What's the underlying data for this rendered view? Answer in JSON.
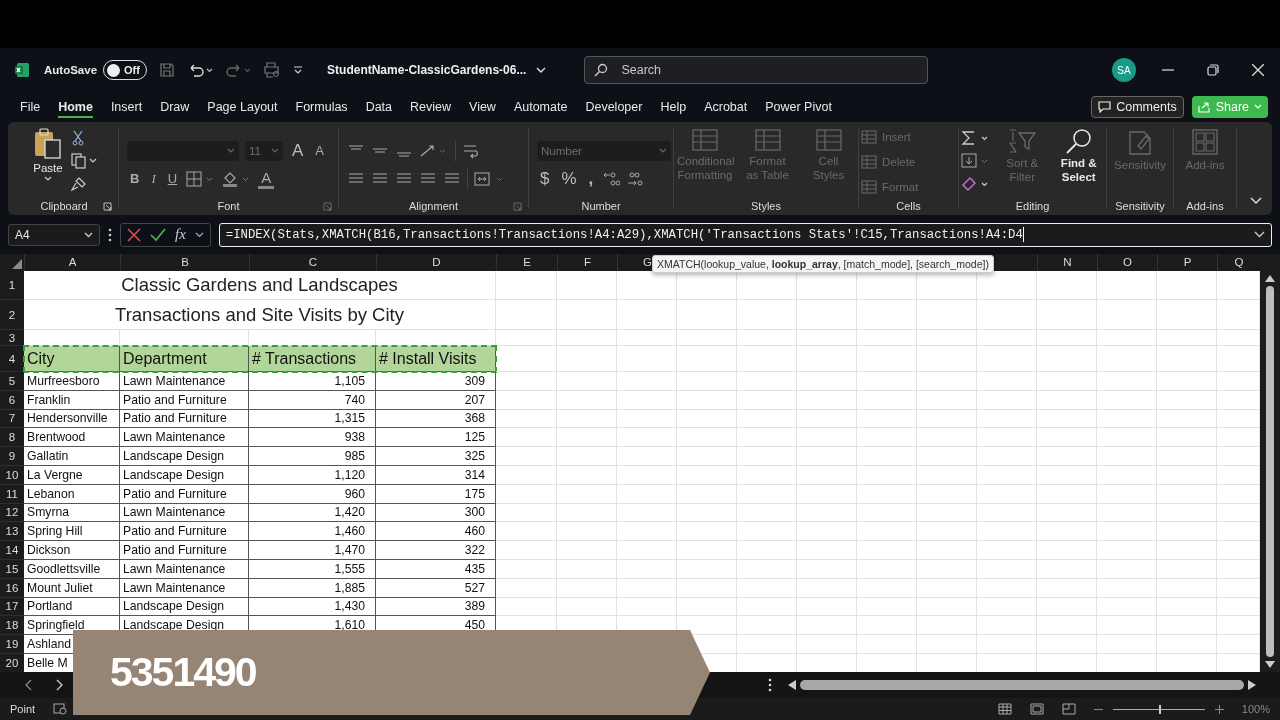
{
  "title_bar": {
    "autosave_label": "AutoSave",
    "autosave": {
      "on": false,
      "label": "Off"
    },
    "file_name": "StudentName-ClassicGardens-06...",
    "search": {
      "placeholder": "Search"
    },
    "avatar": "SA"
  },
  "menu": {
    "tabs": [
      {
        "label": "File",
        "selected": false
      },
      {
        "label": "Home",
        "selected": true
      },
      {
        "label": "Insert",
        "selected": false
      },
      {
        "label": "Draw",
        "selected": false
      },
      {
        "label": "Page Layout",
        "selected": false
      },
      {
        "label": "Formulas",
        "selected": false
      },
      {
        "label": "Data",
        "selected": false
      },
      {
        "label": "Review",
        "selected": false
      },
      {
        "label": "View",
        "selected": false
      },
      {
        "label": "Automate",
        "selected": false
      },
      {
        "label": "Developer",
        "selected": false
      },
      {
        "label": "Help",
        "selected": false
      },
      {
        "label": "Acrobat",
        "selected": false
      },
      {
        "label": "Power Pivot",
        "selected": false
      }
    ],
    "comments": "Comments",
    "share": "Share"
  },
  "ribbon": {
    "clipboard": {
      "label": "Clipboard",
      "paste": "Paste"
    },
    "font": {
      "label": "Font",
      "font_size": "11",
      "grow_font": "A",
      "shrink_font": "A",
      "bold": "B",
      "italic": "I",
      "underline": "U",
      "font_color": "A"
    },
    "alignment": {
      "label": "Alignment"
    },
    "number": {
      "label": "Number",
      "format": {
        "placeholder": "Number"
      },
      "currency": "$",
      "percent": "%",
      "comma": ","
    },
    "styles": {
      "label": "Styles",
      "buttons": [
        {
          "label": "Conditional Formatting",
          "disabled": true
        },
        {
          "label": "Format as Table",
          "disabled": true
        },
        {
          "label": "Cell Styles",
          "disabled": true
        }
      ]
    },
    "cells": {
      "label": "Cells",
      "buttons": [
        {
          "label": "Insert",
          "disabled": true
        },
        {
          "label": "Delete",
          "disabled": true
        },
        {
          "label": "Format",
          "disabled": true
        }
      ]
    },
    "editing": {
      "label": "Editing",
      "sort_filter": {
        "label": "Sort & Filter",
        "disabled": true
      },
      "find_select": {
        "label": "Find & Select",
        "disabled": false
      }
    },
    "sensitivity": {
      "label": "Sensitivity",
      "button": {
        "label": "Sensitivity",
        "disabled": true
      }
    },
    "add_ins": {
      "label": "Add-ins",
      "button": {
        "label": "Add-ins",
        "disabled": true
      }
    }
  },
  "formula_bar": {
    "name_box": "A4",
    "fx": "fx",
    "formula": "=INDEX(Stats,XMATCH(B16,Transactions!Transactions!A4:A29),XMATCH('Transactions Stats'!C15,Transactions!A4:D4"
  },
  "tooltip": "XMATCH(lookup_value, **lookup_array**, [match_mode], [search_mode])",
  "columns_left": [
    "A",
    "B",
    "C",
    "D",
    "E",
    "F",
    "G"
  ],
  "columns_right": [
    "N",
    "O",
    "P",
    "Q"
  ],
  "rows": [
    {
      "num": "1",
      "kind": "title",
      "text": "Classic Gardens and Landscapes"
    },
    {
      "num": "2",
      "kind": "subtitle",
      "text": "Transactions and Site Visits by City"
    },
    {
      "num": "3",
      "kind": "blank"
    },
    {
      "num": "4",
      "kind": "header",
      "cells": [
        "City",
        "Department",
        "# Transactions",
        "# Install Visits"
      ]
    },
    {
      "num": "5",
      "kind": "data",
      "cells": [
        "Murfreesboro",
        "Lawn Maintenance",
        "1,105",
        "309"
      ]
    },
    {
      "num": "6",
      "kind": "data",
      "cells": [
        "Franklin",
        "Patio and Furniture",
        "740",
        "207"
      ]
    },
    {
      "num": "7",
      "kind": "data",
      "cells": [
        "Hendersonville",
        "Patio and Furniture",
        "1,315",
        "368"
      ]
    },
    {
      "num": "8",
      "kind": "data",
      "cells": [
        "Brentwood",
        "Lawn Maintenance",
        "938",
        "125"
      ]
    },
    {
      "num": "9",
      "kind": "data",
      "cells": [
        "Gallatin",
        "Landscape Design",
        "985",
        "325"
      ]
    },
    {
      "num": "10",
      "kind": "data",
      "cells": [
        "La Vergne",
        "Landscape Design",
        "1,120",
        "314"
      ]
    },
    {
      "num": "11",
      "kind": "data",
      "cells": [
        "Lebanon",
        "Patio and Furniture",
        "960",
        "175"
      ]
    },
    {
      "num": "12",
      "kind": "data",
      "cells": [
        "Smyrna",
        "Lawn Maintenance",
        "1,420",
        "300"
      ]
    },
    {
      "num": "13",
      "kind": "data",
      "cells": [
        "Spring Hill",
        "Patio and Furniture",
        "1,460",
        "460"
      ]
    },
    {
      "num": "14",
      "kind": "data",
      "cells": [
        "Dickson",
        "Patio and Furniture",
        "1,470",
        "322"
      ]
    },
    {
      "num": "15",
      "kind": "data",
      "cells": [
        "Goodlettsville",
        "Lawn Maintenance",
        "1,555",
        "435"
      ]
    },
    {
      "num": "16",
      "kind": "data",
      "cells": [
        "Mount Juliet",
        "Lawn Maintenance",
        "1,885",
        "527"
      ]
    },
    {
      "num": "17",
      "kind": "data",
      "cells": [
        "Portland",
        "Landscape Design",
        "1,430",
        "389"
      ]
    },
    {
      "num": "18",
      "kind": "data",
      "cells": [
        "Springfield",
        "Landscape Design",
        "1,610",
        "450"
      ]
    },
    {
      "num": "19",
      "kind": "data",
      "cells": [
        "Ashland"
      ]
    },
    {
      "num": "20",
      "kind": "data",
      "cells": [
        "Belle M"
      ]
    }
  ],
  "status_bar": {
    "mode": "Point",
    "zoom": {
      "level": 0.5
    },
    "zoom_label": "100%"
  },
  "banner": "5351490"
}
